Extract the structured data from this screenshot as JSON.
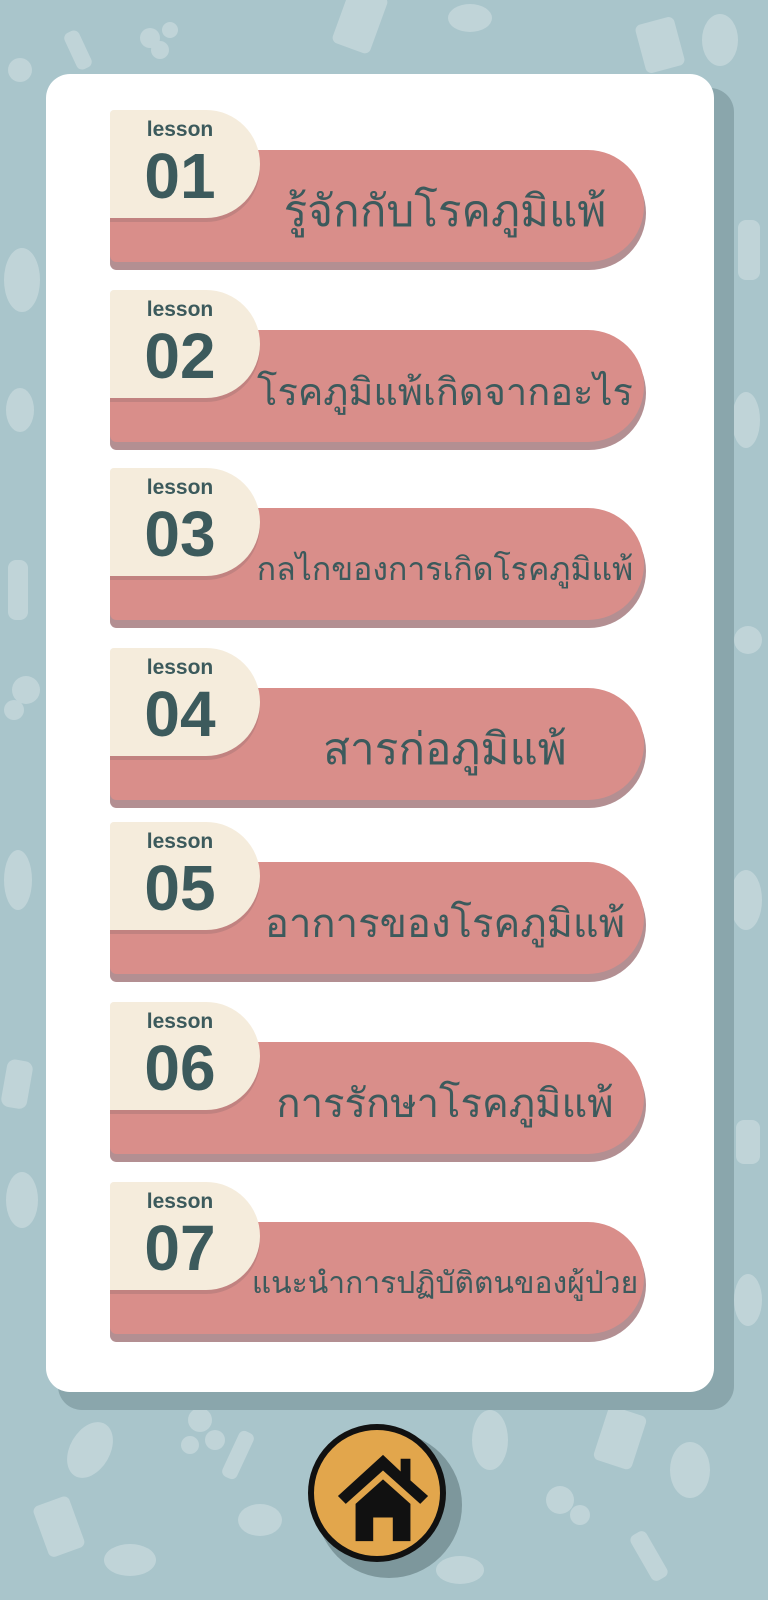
{
  "background_color": "#a9c5cb",
  "card_color": "#ffffff",
  "pill_color": "#d98e8a",
  "tag_color": "#f5ecdc",
  "text_color": "#3c5a5c",
  "home_button_color": "#e2a64c",
  "lessons": [
    {
      "tag": "lesson",
      "number": "01",
      "title": "รู้จักกับโรคภูมิแพ้"
    },
    {
      "tag": "lesson",
      "number": "02",
      "title": "โรคภูมิแพ้เกิดจากอะไร"
    },
    {
      "tag": "lesson",
      "number": "03",
      "title": "กลไกของการเกิดโรคภูมิแพ้"
    },
    {
      "tag": "lesson",
      "number": "04",
      "title": "สารก่อภูมิแพ้"
    },
    {
      "tag": "lesson",
      "number": "05",
      "title": "อาการของโรคภูมิแพ้"
    },
    {
      "tag": "lesson",
      "number": "06",
      "title": "การรักษาโรคภูมิแพ้"
    },
    {
      "tag": "lesson",
      "number": "07",
      "title": "แนะนำการปฏิบัติตนของผู้ป่วย"
    }
  ],
  "home_button": {
    "icon": "home-icon"
  }
}
